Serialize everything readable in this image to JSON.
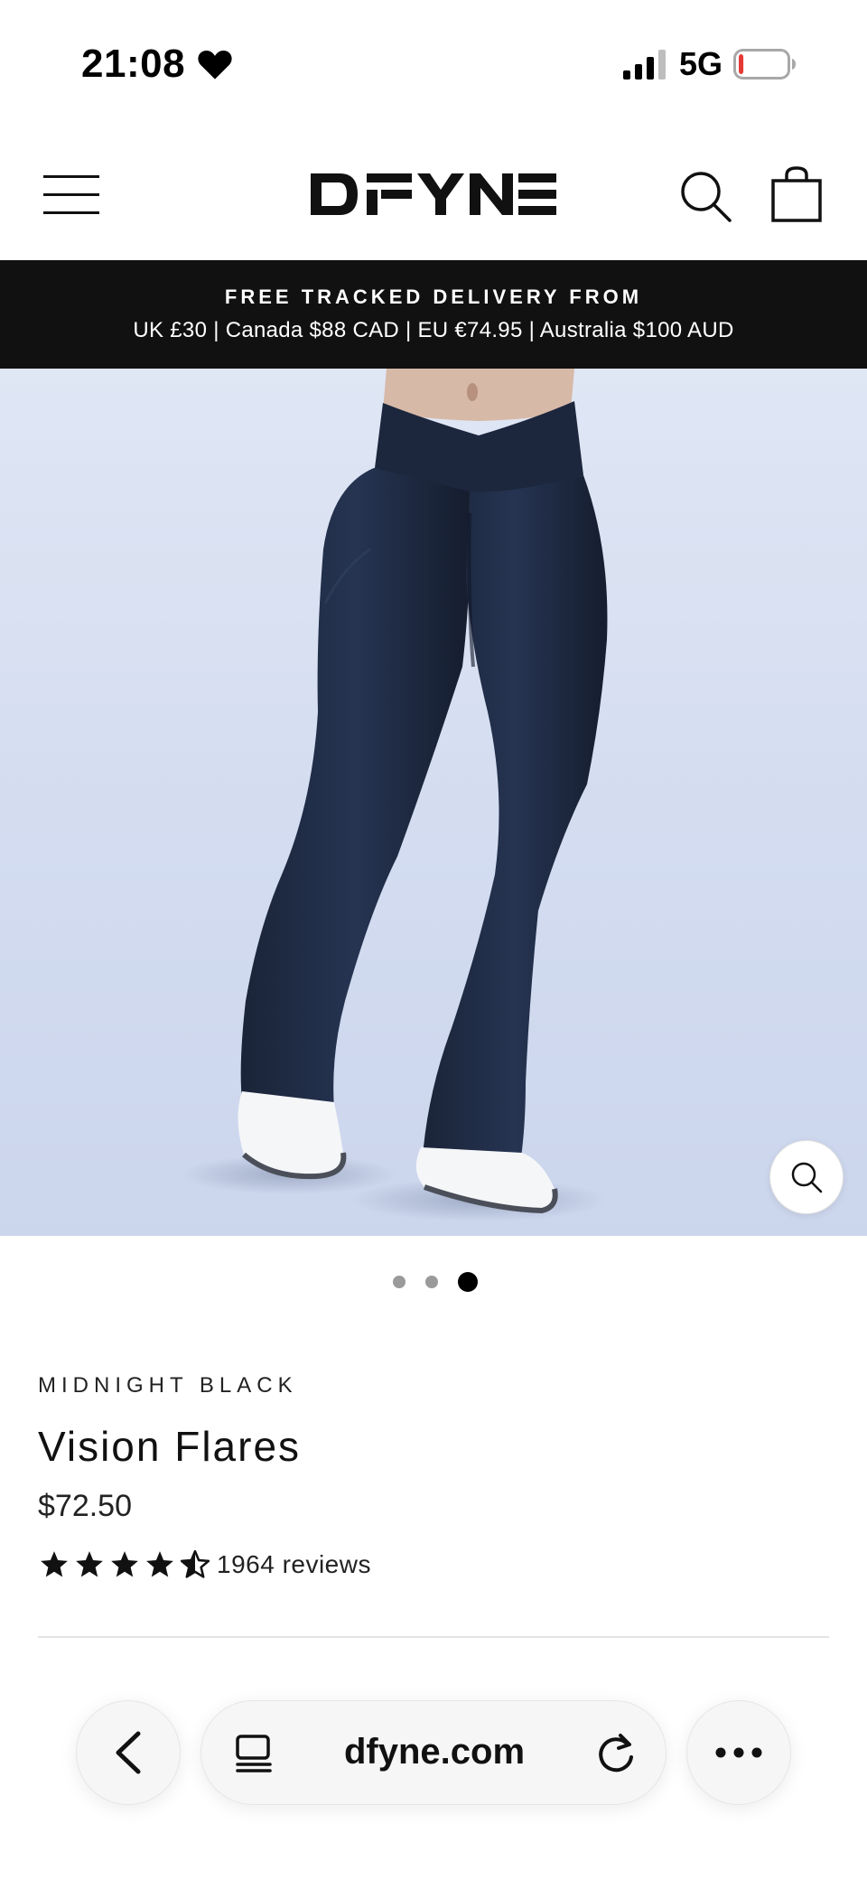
{
  "status_bar": {
    "time": "21:08",
    "network": "5G",
    "battery_level": 0.1,
    "battery_color": "#e53935"
  },
  "header": {
    "logo_text": "DFYNE",
    "icons": [
      "menu-icon",
      "search-icon",
      "shopping-bag-icon"
    ]
  },
  "announcement": {
    "title": "FREE TRACKED DELIVERY FROM",
    "subtitle": "UK £30 | Canada $88 CAD | EU €74.95 | Australia $100 AUD",
    "background": "#111111"
  },
  "gallery": {
    "image_count": 3,
    "active_index": 3,
    "zoom_icon": "zoom-icon"
  },
  "product": {
    "variant": "MIDNIGHT BLACK",
    "title": "Vision Flares",
    "price": "$72.50",
    "rating": 4.5,
    "reviews": "1964 reviews"
  },
  "browser": {
    "url": "dfyne.com",
    "icons": [
      "back-icon",
      "tabs-icon",
      "reload-icon",
      "more-icon"
    ]
  }
}
